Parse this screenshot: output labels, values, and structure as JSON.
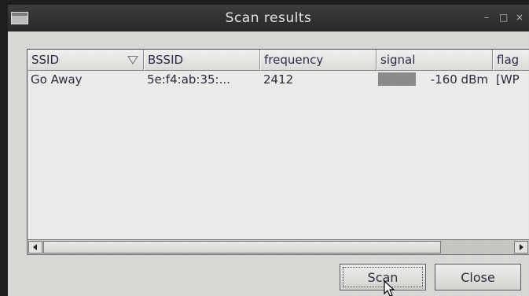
{
  "window": {
    "title": "Scan results",
    "controls": {
      "minimize": "–",
      "maximize": "□",
      "close": "×"
    },
    "icon": "window-menu-icon"
  },
  "results_table": {
    "columns": [
      {
        "key": "ssid",
        "label": "SSID",
        "sorted": "descending"
      },
      {
        "key": "bssid",
        "label": "BSSID"
      },
      {
        "key": "frequency",
        "label": "frequency"
      },
      {
        "key": "signal",
        "label": "signal"
      },
      {
        "key": "flags",
        "label": "flag"
      }
    ],
    "rows": [
      {
        "ssid": "Go Away",
        "bssid": "5e:f4:ab:35:...",
        "frequency": "2412",
        "signal_text": "-160 dBm",
        "signal_level": 0,
        "flags": "[WP"
      }
    ]
  },
  "scrollbar": {
    "left_icon": "arrow-left-icon",
    "right_icon": "arrow-right-icon"
  },
  "buttons": {
    "scan": "Scan",
    "close": "Close"
  },
  "colors": {
    "titlebar": "#2e2e2e",
    "window_bg": "#d9d9d6",
    "list_bg": "#ececea",
    "signal_bar": "#8a8a8a"
  }
}
